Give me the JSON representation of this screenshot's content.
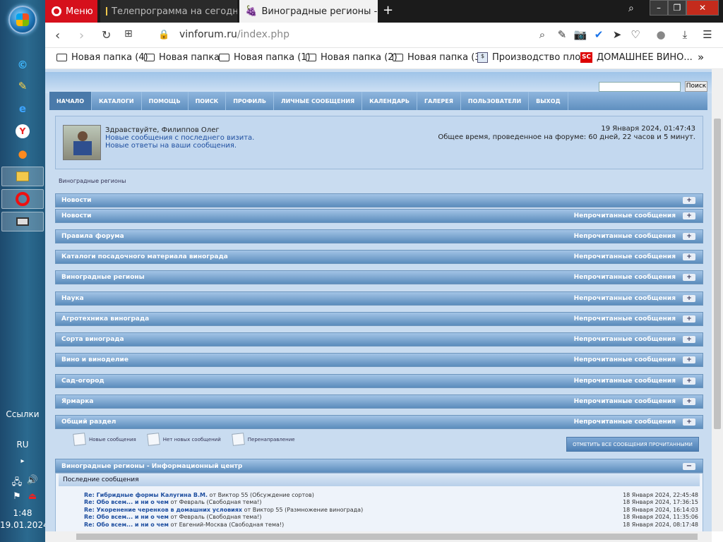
{
  "taskbar": {
    "links_label": "Ссылки",
    "lang": "RU",
    "time": "1:48",
    "date": "19.01.2024"
  },
  "browser": {
    "menu_label": "Меню",
    "tabs": [
      {
        "title": "Телепрограмма на сегодн"
      },
      {
        "title": "Виноградные регионы - В"
      }
    ],
    "url_host": "vinforum.ru",
    "url_path": "/index.php",
    "bookmarks": [
      {
        "label": "Новая папка (4)"
      },
      {
        "label": "Новая папка"
      },
      {
        "label": "Новая папка (1)"
      },
      {
        "label": "Новая папка (2)"
      },
      {
        "label": "Новая папка (3)"
      },
      {
        "label": "Производство пло..."
      },
      {
        "label": "ДОМАШНЕЕ ВИНО..."
      }
    ]
  },
  "forum": {
    "search_btn": "Поиск",
    "nav": [
      {
        "label": "Начало"
      },
      {
        "label": "Каталоги"
      },
      {
        "label": "Помощь"
      },
      {
        "label": "Поиск"
      },
      {
        "label": "Профиль"
      },
      {
        "label": "Личные сообщения"
      },
      {
        "label": "Календарь"
      },
      {
        "label": "Галерея"
      },
      {
        "label": "Пользователи"
      },
      {
        "label": "Выход"
      }
    ],
    "welcome": {
      "greeting": "Здравствуйте, Филиппов Олег",
      "link_new": "Новые сообщения с последнего визита.",
      "link_replies": "Новые ответы на ваши сообщения.",
      "datetime": "19 Января 2024, 01:47:43",
      "time_spent": "Общее время, проведенное на форуме: 60 дней, 22 часов и 5 минут."
    },
    "breadcrumb": "Виноградные регионы",
    "unread_label": "Непрочитанные сообщения",
    "categories": [
      {
        "name": "Новости",
        "unread": ""
      },
      {
        "name": "Новости",
        "unread": "Непрочитанные сообщения"
      },
      {
        "name": "Правила форума",
        "unread": "Непрочитанные сообщения"
      },
      {
        "name": "Каталоги посадочного материала винограда",
        "unread": "Непрочитанные сообщения"
      },
      {
        "name": "Виноградные регионы",
        "unread": "Непрочитанные сообщения"
      },
      {
        "name": "Наука",
        "unread": "Непрочитанные сообщения"
      },
      {
        "name": "Агротехника винограда",
        "unread": "Непрочитанные сообщения"
      },
      {
        "name": "Сорта винограда",
        "unread": "Непрочитанные сообщения"
      },
      {
        "name": "Вино и виноделие",
        "unread": "Непрочитанные сообщения"
      },
      {
        "name": "Сад-огород",
        "unread": "Непрочитанные сообщения"
      },
      {
        "name": "Ярмарка",
        "unread": "Непрочитанные сообщения"
      },
      {
        "name": "Общий раздел",
        "unread": "Непрочитанные сообщения"
      }
    ],
    "legend": {
      "new": "Новые сообщения",
      "none": "Нет новых сообщений",
      "redirect": "Перенаправление"
    },
    "mark_all": "ОТМЕТИТЬ ВСЕ СООБЩЕНИЯ ПРОЧИТАННЫМИ",
    "info_center": "Виноградные регионы - Информационный центр",
    "recent_title": "Последние сообщения",
    "posts": [
      {
        "title": "Re: Гибридные формы Калугина В.М.",
        "rest": " от Виктор 55 (Обсуждение сортов)",
        "date": "18 Января 2024, 22:45:48"
      },
      {
        "title": "Re: Обо всем... и ни о чем",
        "rest": " от Февраль (Свободная тема!)",
        "date": "18 Января 2024, 17:36:15"
      },
      {
        "title": "Re: Укоренение черенков в домашних условиях",
        "rest": " от Виктор 55 (Размножение винограда)",
        "date": "18 Января 2024, 16:14:03"
      },
      {
        "title": "Re: Обо всем... и ни о чем",
        "rest": " от Февраль (Свободная тема!)",
        "date": "18 Января 2024, 11:35:06"
      },
      {
        "title": "Re: Обо всем... и ни о чем",
        "rest": " от Евгений-Москва (Свободная тема!)",
        "date": "18 Января 2024, 08:17:48"
      }
    ]
  }
}
